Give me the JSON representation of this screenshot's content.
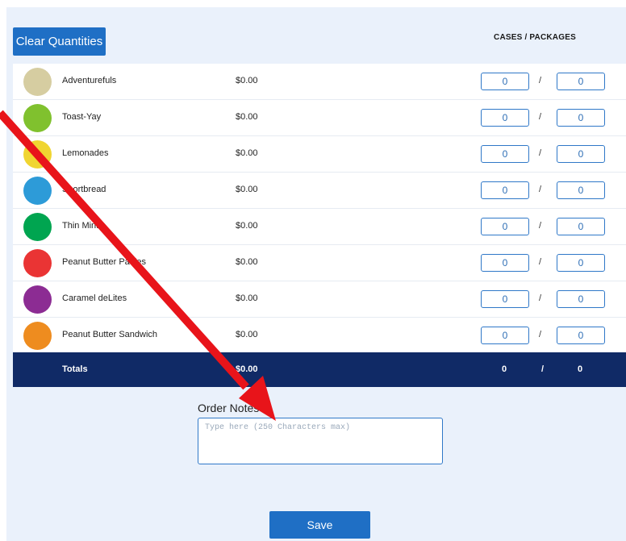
{
  "toolbar": {
    "clear_label": "Clear Quantities"
  },
  "columns": {
    "quantity_header": "CASES / PACKAGES"
  },
  "products": [
    {
      "name": "Adventurefuls",
      "price": "$0.00",
      "cases": "0",
      "packages": "0",
      "color": "#d6cda1"
    },
    {
      "name": "Toast-Yay",
      "price": "$0.00",
      "cases": "0",
      "packages": "0",
      "color": "#80c12e"
    },
    {
      "name": "Lemonades",
      "price": "$0.00",
      "cases": "0",
      "packages": "0",
      "color": "#f0d531"
    },
    {
      "name": "Shortbread",
      "price": "$0.00",
      "cases": "0",
      "packages": "0",
      "color": "#2d9bd8"
    },
    {
      "name": "Thin Mints",
      "price": "$0.00",
      "cases": "0",
      "packages": "0",
      "color": "#00a550"
    },
    {
      "name": "Peanut Butter Patties",
      "price": "$0.00",
      "cases": "0",
      "packages": "0",
      "color": "#ea3434"
    },
    {
      "name": "Caramel deLites",
      "price": "$0.00",
      "cases": "0",
      "packages": "0",
      "color": "#8c2c93"
    },
    {
      "name": "Peanut Butter Sandwich",
      "price": "$0.00",
      "cases": "0",
      "packages": "0",
      "color": "#ee8c1f"
    }
  ],
  "separator": "/",
  "totals": {
    "label": "Totals",
    "price": "$0.00",
    "cases": "0",
    "separator": "/",
    "packages": "0"
  },
  "notes": {
    "label": "Order Notes",
    "placeholder": "Type here (250 Characters max)",
    "value": ""
  },
  "save_label": "Save",
  "colors": {
    "accent": "#1f6fc5",
    "totals_bar": "#102a66",
    "panel_bg": "#eaf1fb",
    "annotation_arrow": "#e8141a"
  }
}
